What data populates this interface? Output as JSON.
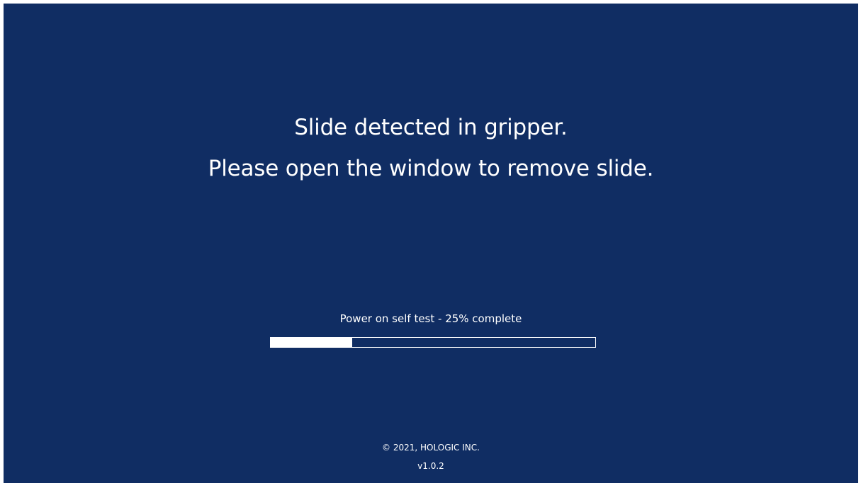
{
  "message": {
    "line1": "Slide detected in gripper.",
    "line2": "Please open the window to remove slide."
  },
  "progress": {
    "label": "Power on self test - 25% complete",
    "fraction": 0.25
  },
  "footer": {
    "copyright": "© 2021, HOLOGIC INC.",
    "version": "v1.0.2"
  },
  "colors": {
    "background": "#102d63",
    "text": "#ffffff",
    "progress_fill": "#ffffff"
  }
}
